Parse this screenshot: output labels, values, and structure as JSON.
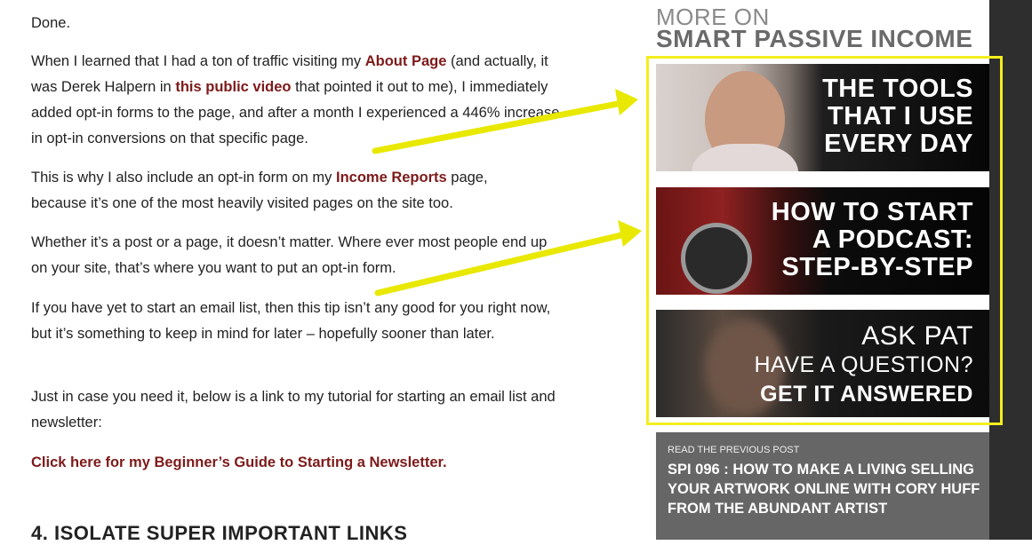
{
  "article": {
    "p1": "Done.",
    "p2": {
      "t1": "When I learned that I had a ton of traffic visiting my ",
      "link1": "About Page",
      "t2": " (and actually, it was Derek Halpern in ",
      "link2": "this public video",
      "t3": " that pointed it out to me), I immediately added opt-in forms to the page, and after a month I experienced a 446% increase in opt-in conversions on that specific page."
    },
    "p3": {
      "t1": "This is why I also include an opt-in form on my ",
      "link": "Income Reports",
      "t2": " page, because it’s one of the most heavily visited pages on the site too."
    },
    "p4": "Whether it’s a post or a page, it doesn’t matter. Where ever most people end up on your site, that’s where you want to put an opt-in form.",
    "p5": "If you have yet to start an email list, then this tip isn’t any good for you right now, but it’s something to keep in mind for later – hopefully sooner than later.",
    "p6": "Just in case you need it, below is a link to my tutorial for starting an email list and newsletter:",
    "cta": "Click here for my Beginner’s Guide to Starting a Newsletter.",
    "heading": "4. ISOLATE SUPER IMPORTANT LINKS"
  },
  "sidebar": {
    "title_line1": "MORE ON",
    "title_line2": "SMART PASSIVE INCOME",
    "banners": [
      {
        "line1": "THE TOOLS",
        "line2": "THAT I USE",
        "line3": "EVERY DAY"
      },
      {
        "line1": "HOW TO START",
        "line2": "A PODCAST:",
        "line3": "STEP-BY-STEP"
      },
      {
        "line1": "ASK PAT",
        "line2": "HAVE A QUESTION?",
        "line3": "GET IT ANSWERED"
      }
    ],
    "prev_label": "READ THE PREVIOUS POST",
    "prev_title": "SPI 096 : HOW TO MAKE A LIVING SELLING YOUR ARTWORK ONLINE WITH CORY HUFF FROM THE ABUNDANT ARTIST"
  },
  "colors": {
    "link": "#7d1a1a",
    "highlight": "#f4ee1e",
    "sidebar_dark": "#2e2e2e",
    "prev_bg": "#666666"
  }
}
